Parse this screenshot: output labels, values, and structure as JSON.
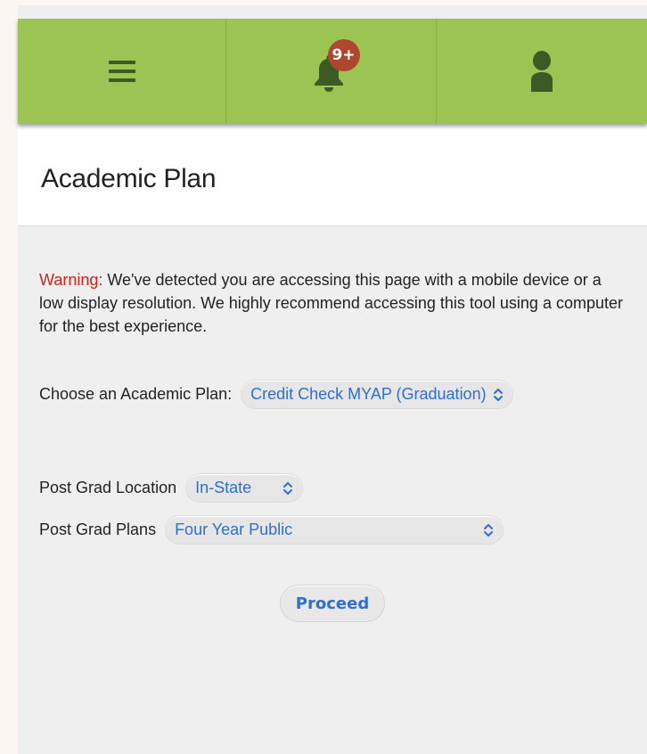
{
  "topbar": {
    "notification_badge": "9+",
    "accent_color": "#9bc454",
    "icons": [
      "menu-icon",
      "bell-icon",
      "user-icon"
    ]
  },
  "header": {
    "title": "Academic Plan"
  },
  "warning": {
    "label": "Warning:",
    "text": " We've detected you are accessing this page with a mobile device or a low display resolution. We highly recommend accessing this tool using a computer for the best experience."
  },
  "form": {
    "academic_plan_label": "Choose an Academic Plan:",
    "academic_plan_value": "Credit Check MYAP (Graduation)",
    "post_grad_location_label": "Post Grad Location",
    "post_grad_location_value": "In-State",
    "post_grad_plans_label": "Post Grad Plans",
    "post_grad_plans_value": "Four Year Public"
  },
  "actions": {
    "proceed_label": "Proceed"
  }
}
